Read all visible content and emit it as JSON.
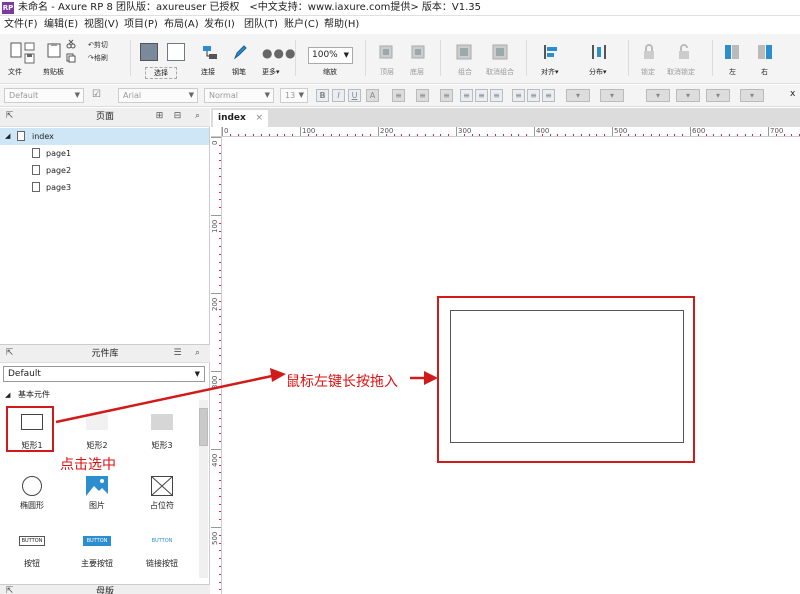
{
  "window": {
    "title": "未命名 - Axure RP 8 团队版：axureuser 已授权　<中文支持：www.iaxure.com提供> 版本：V1.35",
    "logo_text": "RP"
  },
  "menu": [
    "文件(F)",
    "编辑(E)",
    "视图(V)",
    "项目(P)",
    "布局(A)",
    "发布(I)",
    "团队(T)",
    "账户(C)",
    "帮助(H)"
  ],
  "toolbar": {
    "file": "文件",
    "clipboard": "剪贴板",
    "cut": "剪切",
    "copy": "复制",
    "paste_format": "格刷",
    "select": "选择",
    "connect": "连接",
    "pen": "钢笔",
    "more": "更多▾",
    "zoom_value": "100%",
    "zoom_label": "缩放",
    "top": "顶层",
    "bottom": "底层",
    "group": "组合",
    "ungroup": "取消组合",
    "align": "对齐▾",
    "distribute": "分布▾",
    "lock": "锁定",
    "unlock": "取消锁定",
    "left": "左",
    "right": "右"
  },
  "formatbar": {
    "style": "Default",
    "font": "Arial",
    "weight": "Normal",
    "size": "13",
    "bold": "B",
    "italic": "I",
    "underline": "U"
  },
  "pages_panel": {
    "title": "页面",
    "items": [
      "index",
      "page1",
      "page2",
      "page3"
    ]
  },
  "library_panel": {
    "title": "元件库",
    "selected_library": "Default",
    "category": "基本元件",
    "widgets": [
      "矩形1",
      "矩形2",
      "矩形3",
      "椭圆形",
      "图片",
      "占位符",
      "按钮",
      "主要按钮",
      "链接按钮"
    ],
    "button_text": "BUTTON"
  },
  "masters_panel": {
    "title": "母版"
  },
  "canvas": {
    "tab": "index",
    "h_ruler": [
      "0",
      "100",
      "200",
      "300",
      "400",
      "500",
      "600",
      "700"
    ],
    "v_ruler": [
      "0",
      "100",
      "200",
      "300",
      "400",
      "500"
    ]
  },
  "annotations": {
    "click_select": "点击选中",
    "drag_in": "鼠标左键长按拖入"
  },
  "colors": {
    "annotation": "#d11a1a",
    "ruler_ticks": "#e21d6a",
    "selected_row": "#cfe6f7",
    "button_blue": "#2c8dcf"
  }
}
